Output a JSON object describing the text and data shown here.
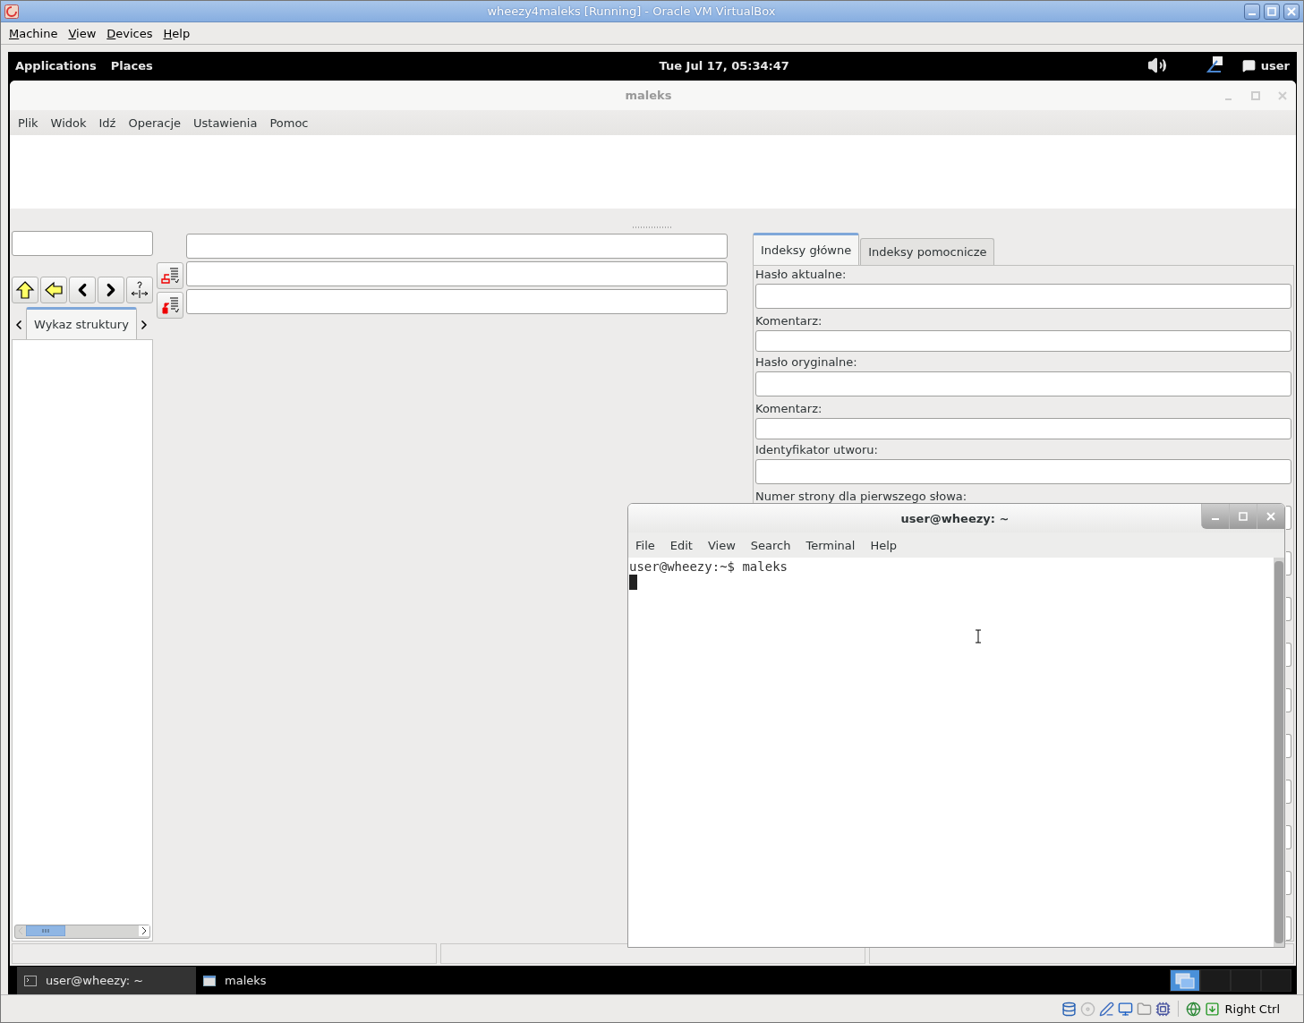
{
  "host_window": {
    "title": "wheezy4maleks [Running] - Oracle VM VirtualBox"
  },
  "host_menu": [
    "Machine",
    "View",
    "Devices",
    "Help"
  ],
  "top_panel": {
    "menus": [
      "Applications",
      "Places"
    ],
    "clock": "Tue Jul 17, 05:34:47",
    "user": "user"
  },
  "app_window": {
    "title": "maleks",
    "menu": [
      "Plik",
      "Widok",
      "Idź",
      "Operacje",
      "Ustawienia",
      "Pomoc"
    ]
  },
  "left_tabs": [
    {
      "label": "Wykaz struktury",
      "selected": true
    }
  ],
  "right_tabs": [
    {
      "label": "Indeksy główne",
      "selected": true
    },
    {
      "label": "Indeksy pomocnicze",
      "selected": false
    }
  ],
  "form_fields": [
    {
      "label": "Hasło aktualne:",
      "kind": "tall"
    },
    {
      "label": "Komentarz:",
      "kind": "short"
    },
    {
      "label": "Hasło oryginalne:",
      "kind": "tall"
    },
    {
      "label": "Komentarz:",
      "kind": "short"
    },
    {
      "label": "Identyfikator utworu:",
      "kind": "tall"
    }
  ],
  "form_cut_label": "Numer strony dla pierwszego słowa:",
  "terminal": {
    "title": "user@wheezy: ~",
    "menu": [
      "File",
      "Edit",
      "View",
      "Search",
      "Terminal",
      "Help"
    ],
    "lines": [
      "user@wheezy:~$ maleks"
    ]
  },
  "taskbar": {
    "tasks": [
      {
        "label": "user@wheezy: ~",
        "kind": "terminal",
        "selected": true
      },
      {
        "label": "maleks",
        "kind": "window",
        "selected": false
      }
    ],
    "workspaces": [
      {
        "selected": true
      },
      {
        "selected": false
      },
      {
        "selected": false
      },
      {
        "selected": false
      }
    ]
  },
  "host_status": {
    "key": "Right Ctrl"
  }
}
